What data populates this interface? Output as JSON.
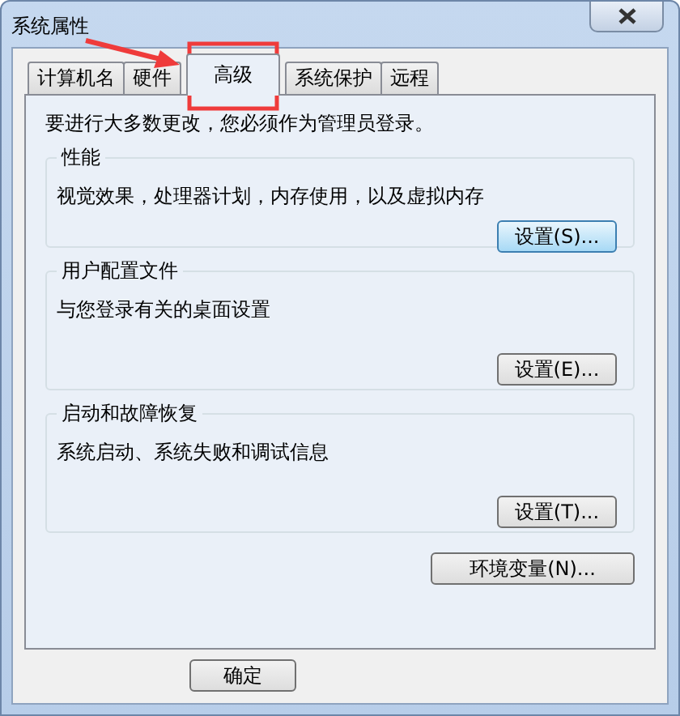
{
  "window": {
    "title": "系统属性"
  },
  "tabs": [
    {
      "label": "计算机名",
      "selected": false
    },
    {
      "label": "硬件",
      "selected": false
    },
    {
      "label": "高级",
      "selected": true
    },
    {
      "label": "系统保护",
      "selected": false
    },
    {
      "label": "远程",
      "selected": false
    }
  ],
  "notice": "要进行大多数更改，您必须作为管理员登录。",
  "groups": [
    {
      "title": "性能",
      "description": "视觉效果，处理器计划，内存使用，以及虚拟内存",
      "button": "设置(S)...",
      "focused": true
    },
    {
      "title": "用户配置文件",
      "description": "与您登录有关的桌面设置",
      "button": "设置(E)...",
      "focused": false
    },
    {
      "title": "启动和故障恢复",
      "description": "系统启动、系统失败和调试信息",
      "button": "设置(T)...",
      "focused": false
    }
  ],
  "env_button": "环境变量(N)...",
  "footer_buttons": [
    "确定"
  ]
}
